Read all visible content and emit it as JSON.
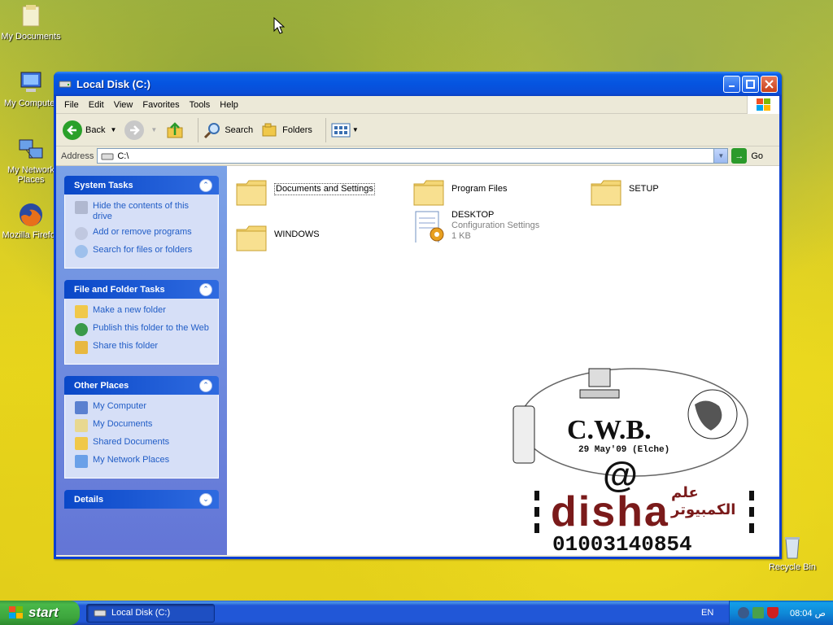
{
  "desktop": {
    "icons": [
      {
        "label": "My Documents"
      },
      {
        "label": "My Computer"
      },
      {
        "label": "My Network Places"
      },
      {
        "label": "Mozilla Firefox"
      },
      {
        "label": "Recycle Bin"
      }
    ]
  },
  "window": {
    "title": "Local Disk (C:)",
    "menu": [
      "File",
      "Edit",
      "View",
      "Favorites",
      "Tools",
      "Help"
    ],
    "toolbar": {
      "back": "Back",
      "search": "Search",
      "folders": "Folders"
    },
    "address": {
      "label": "Address",
      "value": "C:\\",
      "go": "Go"
    },
    "taskpane": {
      "system_tasks": {
        "title": "System Tasks",
        "items": [
          "Hide the contents of this drive",
          "Add or remove programs",
          "Search for files or folders"
        ]
      },
      "file_folder_tasks": {
        "title": "File and Folder Tasks",
        "items": [
          "Make a new folder",
          "Publish this folder to the Web",
          "Share this folder"
        ]
      },
      "other_places": {
        "title": "Other Places",
        "items": [
          "My Computer",
          "My Documents",
          "Shared Documents",
          "My Network Places"
        ]
      },
      "details": {
        "title": "Details"
      }
    },
    "files": [
      {
        "name": "Documents and Settings"
      },
      {
        "name": "Program Files"
      },
      {
        "name": "SETUP"
      },
      {
        "name": "WINDOWS"
      },
      {
        "name": "DESKTOP",
        "type": "Configuration Settings",
        "size": "1 KB"
      }
    ],
    "watermark": {
      "brand": "C.W.B.",
      "date": "29 May'09 (Elche)",
      "at": "@",
      "arabic": "علم الكمبيوتر",
      "name": "disha",
      "phone": "01003140854"
    }
  },
  "taskbar": {
    "start": "start",
    "task_button": "Local Disk (C:)",
    "lang": "EN",
    "clock": "08:04 ص"
  }
}
